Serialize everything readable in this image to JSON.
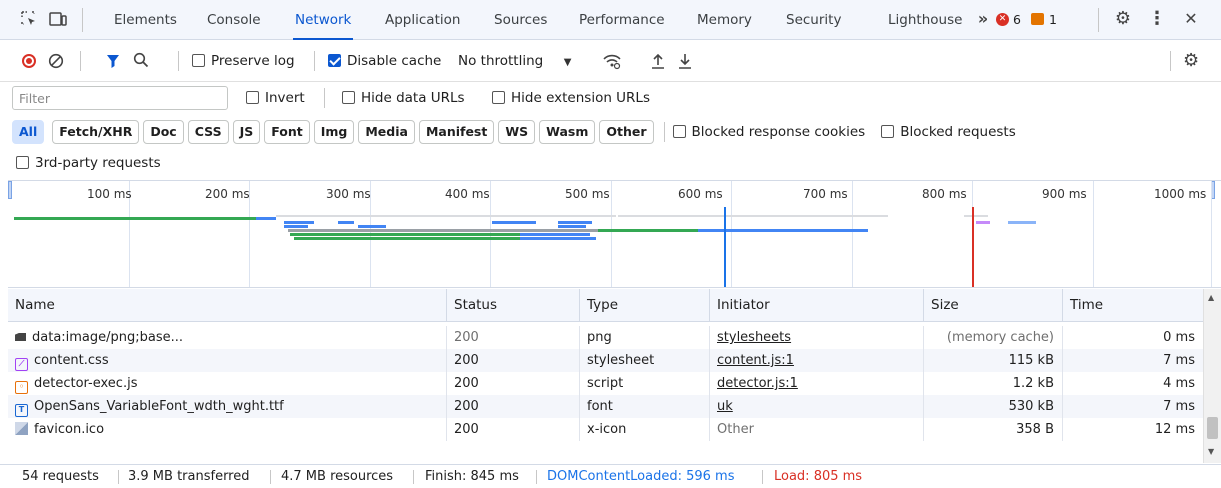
{
  "tabs": [
    "Elements",
    "Console",
    "Network",
    "Application",
    "Sources",
    "Performance",
    "Memory",
    "Security",
    "Lighthouse"
  ],
  "active_tab": "Network",
  "badges": {
    "errors": "6",
    "warnings": "1"
  },
  "toolbar": {
    "preserve_log": "Preserve log",
    "disable_cache": "Disable cache",
    "throttling": "No throttling"
  },
  "filter": {
    "placeholder": "Filter",
    "invert": "Invert",
    "hide_data_urls": "Hide data URLs",
    "hide_extension_urls": "Hide extension URLs"
  },
  "type_filters": [
    "All",
    "Fetch/XHR",
    "Doc",
    "CSS",
    "JS",
    "Font",
    "Img",
    "Media",
    "Manifest",
    "WS",
    "Wasm",
    "Other"
  ],
  "selected_type": "All",
  "blocked_response_cookies": "Blocked response cookies",
  "blocked_requests": "Blocked requests",
  "third_party": "3rd-party requests",
  "overview_ticks": [
    "100 ms",
    "200 ms",
    "300 ms",
    "400 ms",
    "500 ms",
    "600 ms",
    "700 ms",
    "800 ms",
    "900 ms",
    "1000 ms"
  ],
  "columns": [
    "Name",
    "Status",
    "Type",
    "Initiator",
    "Size",
    "Time"
  ],
  "rows": [
    {
      "name": "data:image/png;base...",
      "icon": "image-icon",
      "status": "200",
      "type": "png",
      "initiator": "stylesheets",
      "size": "(memory cache)",
      "time": "0 ms"
    },
    {
      "name": "content.css",
      "icon": "stylesheet-icon",
      "status": "200",
      "type": "stylesheet",
      "initiator": "content.js:1",
      "size": "115 kB",
      "time": "7 ms"
    },
    {
      "name": "detector-exec.js",
      "icon": "script-icon",
      "status": "200",
      "type": "script",
      "initiator": "detector.js:1",
      "size": "1.2 kB",
      "time": "4 ms"
    },
    {
      "name": "OpenSans_VariableFont_wdth_wght.ttf",
      "icon": "font-icon",
      "status": "200",
      "type": "font",
      "initiator": "uk",
      "size": "530 kB",
      "time": "7 ms"
    },
    {
      "name": "favicon.ico",
      "icon": "favicon-icon",
      "status": "200",
      "type": "x-icon",
      "initiator": "Other",
      "size": "358 B",
      "time": "12 ms"
    }
  ],
  "status": {
    "requests": "54 requests",
    "transferred": "3.9 MB transferred",
    "resources": "4.7 MB resources",
    "finish": "Finish: 845 ms",
    "dom_content_loaded": "DOMContentLoaded: 596 ms",
    "load": "Load: 805 ms"
  },
  "colors": {
    "accent": "#0b57d0",
    "dcl": "#1a73e8",
    "load": "#d93025",
    "green_bar": "#34a853"
  }
}
